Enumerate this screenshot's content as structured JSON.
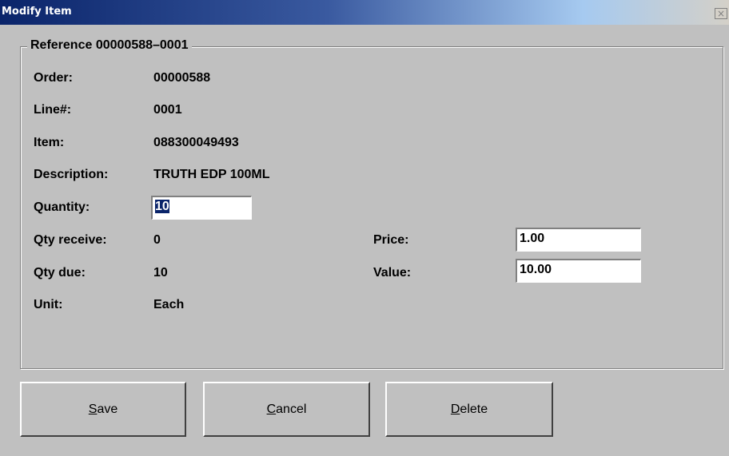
{
  "window": {
    "title": "Modify Item",
    "close_glyph": "×"
  },
  "group": {
    "legend": "Reference 00000588–0001"
  },
  "fields": {
    "order": {
      "label": "Order:",
      "value": "00000588"
    },
    "line": {
      "label": "Line#:",
      "value": "0001"
    },
    "item": {
      "label": "Item:",
      "value": "088300049493"
    },
    "description": {
      "label": "Description:",
      "value": "TRUTH EDP 100ML"
    },
    "quantity": {
      "label": "Quantity:",
      "value": "10"
    },
    "qty_receive": {
      "label": "Qty receive:",
      "value": "0"
    },
    "qty_due": {
      "label": "Qty due:",
      "value": "10"
    },
    "unit": {
      "label": "Unit:",
      "value": "Each"
    },
    "price": {
      "label": "Price:",
      "value": "1.00"
    },
    "value": {
      "label": "Value:",
      "value": "10.00"
    }
  },
  "buttons": {
    "save": {
      "accel": "S",
      "rest": "ave"
    },
    "cancel": {
      "accel": "C",
      "rest": "ancel"
    },
    "delete": {
      "accel": "D",
      "rest": "elete"
    }
  },
  "colors": {
    "title_start": "#0a246a",
    "title_end": "#a6caf0",
    "window_bg": "#c0c0c0",
    "selection": "#0a246a"
  }
}
